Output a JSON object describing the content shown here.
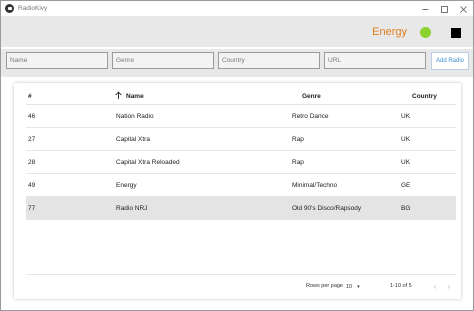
{
  "window": {
    "title": "RadioKivy"
  },
  "header": {
    "mood_label": "Energy",
    "mood_color": "#e07b1f",
    "status_dot_color": "#8bd22f"
  },
  "filters": {
    "name_placeholder": "Name",
    "genre_placeholder": "Genre",
    "country_placeholder": "Country",
    "url_placeholder": "URL",
    "add_button_label": "Add Radio"
  },
  "table": {
    "columns": {
      "num": "#",
      "name": "Name",
      "genre": "Genre",
      "country": "Country"
    },
    "sort_icon": "arrow-up-icon",
    "rows": [
      {
        "num": "46",
        "name": "Nation Radio",
        "genre": "Retro Dance",
        "country": "UK"
      },
      {
        "num": "27",
        "name": "Capital Xtra",
        "genre": "Rap",
        "country": "UK"
      },
      {
        "num": "28",
        "name": "Capital Xtra Reloaded",
        "genre": "Rap",
        "country": "UK"
      },
      {
        "num": "49",
        "name": "Energy",
        "genre": "Minimal/Techno",
        "country": "GE"
      },
      {
        "num": "77",
        "name": "Radio NRJ",
        "genre": "Old 90's Disco/Rapsody",
        "country": "BG"
      }
    ],
    "selected_row": 4,
    "footer": {
      "rows_per_page_label": "Rows per page",
      "rows_per_page_value": "10",
      "page_range": "1-10 of 5"
    }
  }
}
